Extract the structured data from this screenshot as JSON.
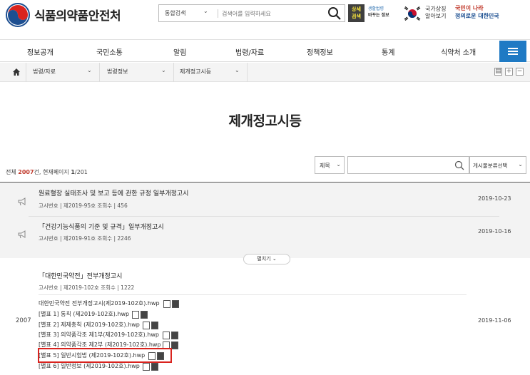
{
  "header": {
    "brand": "식품의약품안전처",
    "search_scope": "통합검색",
    "search_placeholder": "검색어를 입력하세요",
    "detail_search_line1": "상세",
    "detail_search_line2": "검색",
    "law_logo_line1": "생활법령",
    "law_logo_line2": "바꾸는 정보",
    "flag_text_line1": "국가상징",
    "flag_text_line2": "알아보기",
    "slogan_line1": "국민이 나라",
    "slogan_line2": "정의로운 대한민국"
  },
  "nav": {
    "items": [
      "정보공개",
      "국민소통",
      "알림",
      "법령/자료",
      "정책정보",
      "통계",
      "식약처 소개"
    ]
  },
  "breadcrumb": {
    "items": [
      "법령/자료",
      "법령정보",
      "제개정고시등"
    ]
  },
  "page": {
    "title": "제개정고시등"
  },
  "list": {
    "count_prefix": "전체 ",
    "count_total": "2007",
    "count_mid": "건, 현재페이지 ",
    "count_page": "1",
    "count_suffix": "/201",
    "filter_field": "제목",
    "category_placeholder": "게시물분류선택",
    "expand_label": "펼치기 ⌄"
  },
  "pinned": [
    {
      "title": "원료혈장 실태조사 및 보고 등에 관한 규정 일부개정고시",
      "meta": "고시번호 | 제2019-95호     조회수 | 456",
      "date": "2019-10-23"
    },
    {
      "title": "「건강기능식품의 기준 및 규격」일부개정고시",
      "meta": "고시번호 | 제2019-91호     조회수 | 2246",
      "date": "2019-10-16"
    }
  ],
  "entry": {
    "number": "2007",
    "title": "「대한민국약전」전부개정고시",
    "meta": "고시번호 | 제2019-102호     조회수 | 1222",
    "date": "2019-11-06",
    "files": [
      "대한민국약전 전부개정고시(제2019-102호).hwp",
      "[별표 1] 통칙 (제2019-102호).hwp",
      "[별표 2] 제제총칙 (제2019-102호).hwp",
      "[별표 3] 의약품각조 제1부(제2019-102호).hwp",
      "[별표 4] 의약품각조 제2부 (제2019-102호).hwp",
      "[별표 5] 일반시험법 (제2019-102호).hwp",
      "[별표 6] 일반정보 (제2019-102호).hwp"
    ]
  },
  "colors": {
    "accent": "#1f7ac4",
    "highlight": "#d9231e",
    "count_highlight": "#c0392b"
  }
}
